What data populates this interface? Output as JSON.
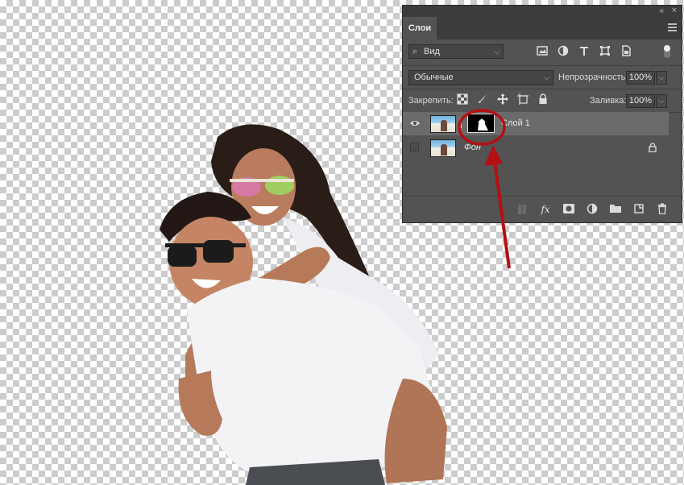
{
  "panel": {
    "tab_label": "Слои",
    "collapse_glyph": "«",
    "close_glyph": "×",
    "filter": {
      "search_glyph": "⌕",
      "value": "Вид",
      "chevron": "⌵"
    },
    "filter_icons": [
      "image-filter-icon",
      "adjustment-filter-icon",
      "type-filter-icon",
      "shape-filter-icon",
      "smart-object-filter-icon"
    ],
    "blend_mode": "Обычные",
    "opacity_label": "Непрозрачность:",
    "opacity_value": "100%",
    "lock_label": "Закрепить:",
    "lock_icons": [
      "lock-transparent-icon",
      "lock-image-icon",
      "lock-position-icon",
      "lock-artboard-icon",
      "lock-all-icon"
    ],
    "fill_label": "Заливка:",
    "fill_value": "100%",
    "layers": [
      {
        "name": "Слой 1",
        "visible": true,
        "selected": true,
        "has_mask": true,
        "locked": false
      },
      {
        "name": "Фон",
        "visible": false,
        "selected": false,
        "has_mask": false,
        "locked": true
      }
    ],
    "bottom_icons": {
      "link": "⛓",
      "fx": "fx",
      "mask": "◘",
      "adjust": "◐",
      "group": "▬",
      "new": "▫",
      "delete": "🗑"
    }
  },
  "annotation": {
    "color": "#b50f12"
  }
}
